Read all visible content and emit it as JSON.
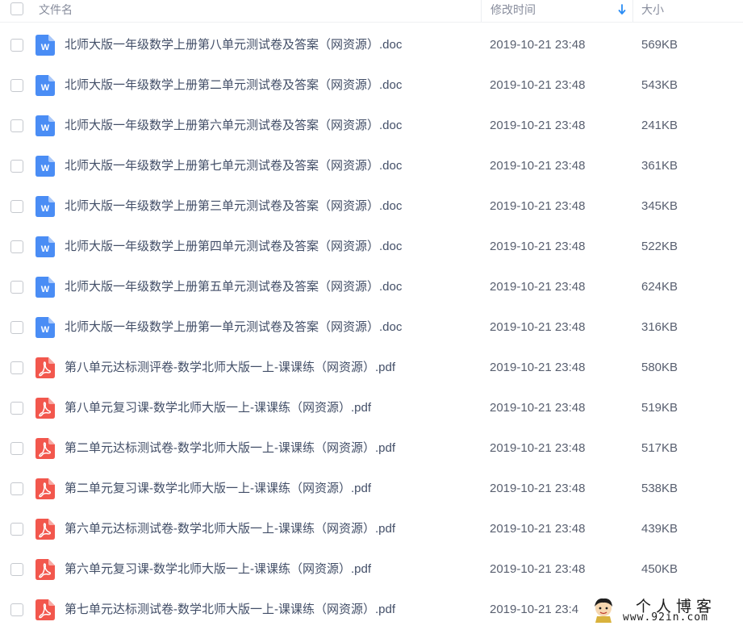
{
  "header": {
    "name_label": "文件名",
    "time_label": "修改时间",
    "size_label": "大小"
  },
  "colors": {
    "word": "#4a8df5",
    "pdf": "#f2574d",
    "sort_arrow": "#2a8cf4"
  },
  "files": [
    {
      "name": "北师大版一年级数学上册第八单元测试卷及答案（网资源）.doc",
      "type": "doc",
      "icon": "word-icon",
      "time": "2019-10-21 23:48",
      "size": "569KB"
    },
    {
      "name": "北师大版一年级数学上册第二单元测试卷及答案（网资源）.doc",
      "type": "doc",
      "icon": "word-icon",
      "time": "2019-10-21 23:48",
      "size": "543KB"
    },
    {
      "name": "北师大版一年级数学上册第六单元测试卷及答案（网资源）.doc",
      "type": "doc",
      "icon": "word-icon",
      "time": "2019-10-21 23:48",
      "size": "241KB"
    },
    {
      "name": "北师大版一年级数学上册第七单元测试卷及答案（网资源）.doc",
      "type": "doc",
      "icon": "word-icon",
      "time": "2019-10-21 23:48",
      "size": "361KB"
    },
    {
      "name": "北师大版一年级数学上册第三单元测试卷及答案（网资源）.doc",
      "type": "doc",
      "icon": "word-icon",
      "time": "2019-10-21 23:48",
      "size": "345KB"
    },
    {
      "name": "北师大版一年级数学上册第四单元测试卷及答案（网资源）.doc",
      "type": "doc",
      "icon": "word-icon",
      "time": "2019-10-21 23:48",
      "size": "522KB"
    },
    {
      "name": "北师大版一年级数学上册第五单元测试卷及答案（网资源）.doc",
      "type": "doc",
      "icon": "word-icon",
      "time": "2019-10-21 23:48",
      "size": "624KB"
    },
    {
      "name": "北师大版一年级数学上册第一单元测试卷及答案（网资源）.doc",
      "type": "doc",
      "icon": "word-icon",
      "time": "2019-10-21 23:48",
      "size": "316KB"
    },
    {
      "name": "第八单元达标测评卷-数学北师大版一上-课课练（网资源）.pdf",
      "type": "pdf",
      "icon": "pdf-icon",
      "time": "2019-10-21 23:48",
      "size": "580KB"
    },
    {
      "name": "第八单元复习课-数学北师大版一上-课课练（网资源）.pdf",
      "type": "pdf",
      "icon": "pdf-icon",
      "time": "2019-10-21 23:48",
      "size": "519KB"
    },
    {
      "name": "第二单元达标测试卷-数学北师大版一上-课课练（网资源）.pdf",
      "type": "pdf",
      "icon": "pdf-icon",
      "time": "2019-10-21 23:48",
      "size": "517KB"
    },
    {
      "name": "第二单元复习课-数学北师大版一上-课课练（网资源）.pdf",
      "type": "pdf",
      "icon": "pdf-icon",
      "time": "2019-10-21 23:48",
      "size": "538KB"
    },
    {
      "name": "第六单元达标测试卷-数学北师大版一上-课课练（网资源）.pdf",
      "type": "pdf",
      "icon": "pdf-icon",
      "time": "2019-10-21 23:48",
      "size": "439KB"
    },
    {
      "name": "第六单元复习课-数学北师大版一上-课课练（网资源）.pdf",
      "type": "pdf",
      "icon": "pdf-icon",
      "time": "2019-10-21 23:48",
      "size": "450KB"
    },
    {
      "name": "第七单元达标测试卷-数学北师大版一上-课课练（网资源）.pdf",
      "type": "pdf",
      "icon": "pdf-icon",
      "time": "2019-10-21 23:4",
      "size": ""
    }
  ],
  "watermark": {
    "title": "个人博客",
    "url": "www.92in.com"
  }
}
